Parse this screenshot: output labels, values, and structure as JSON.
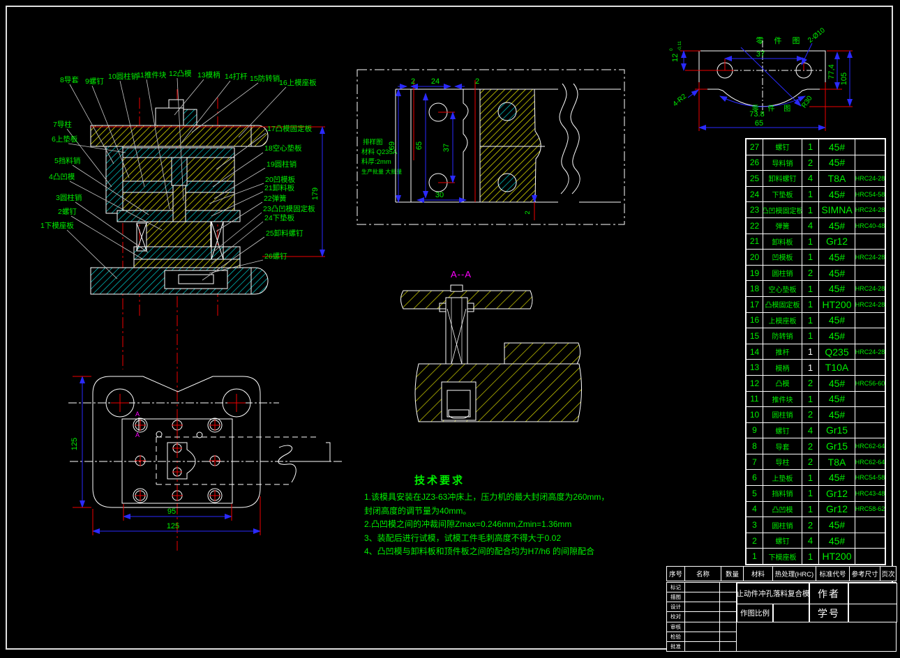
{
  "assembly": {
    "dim_height": "179",
    "labels_top": [
      "8导套",
      "9螺钉",
      "10圆柱销",
      "11推件块",
      "12凸模",
      "13模柄",
      "14打杆",
      "15防转销",
      "16上模座板"
    ],
    "labels_left": [
      "7导柱",
      "6上垫板",
      "5挡料销",
      "4凸凹模",
      "3圆柱销",
      "2螺钉",
      "1下模座板"
    ],
    "labels_right": [
      "17凸模固定板",
      "18空心垫板",
      "19圆柱销",
      "20凹模板",
      "21卸料板",
      "22弹簧",
      "23凸凹模固定板",
      "24下垫板",
      "25卸料螺钉",
      "26螺钉"
    ]
  },
  "plan": {
    "dims": {
      "left": "125",
      "inner": "95",
      "outer": "125"
    },
    "section_marker": "A"
  },
  "strip": {
    "info": [
      "排样图",
      "材料 Q235A",
      "料厚:2mm",
      "生产批量 大批量"
    ],
    "dims": {
      "t1": "2",
      "t2": "24",
      "t3": "2",
      "left": "69",
      "inner": "65",
      "center": "37",
      "bottom": "30",
      "edge": "2"
    }
  },
  "section_aa": {
    "label": "A--A"
  },
  "part": {
    "title": "零 件 图",
    "dims": {
      "tol_main": "12",
      "tol_sup": "0",
      "tol_sub": "-0,11",
      "holes": "2-Ø10",
      "centers": "37",
      "h1": "77,4",
      "h2": "105",
      "corner": "4-R2",
      "arc": "73.8",
      "radius": "R30",
      "width": "65"
    }
  },
  "tech": {
    "title": "技术要求",
    "lines": [
      "1.该模具安装在JZ3-63冲床上，压力机的最大封闭高度为260mm，",
      "封闭高度的调节量为40mm。",
      "2.凸凹模之间的冲裁间隙Zmax=0.246mm,Zmin=1.36mm",
      "3、装配后进行试模，试模工件毛刺高度不得大于0.02",
      "4、凸凹模与卸料板和顶件板之间的配合均为H7/h6 的间隙配合"
    ]
  },
  "bom": {
    "rows": [
      [
        27,
        "螺钉",
        "1",
        "45#",
        ""
      ],
      [
        26,
        "导料销",
        "2",
        "45#",
        ""
      ],
      [
        25,
        "卸料螺钉",
        "4",
        "T8A",
        "HRC24-28"
      ],
      [
        24,
        "下垫板",
        "1",
        "45#",
        "HRC54-58"
      ],
      [
        23,
        "凸凹模固定板",
        "1",
        "SIMNA",
        "HRC24-28"
      ],
      [
        22,
        "弹簧",
        "4",
        "45#",
        "HRC40-48"
      ],
      [
        21,
        "卸料板",
        "1",
        "Gr12",
        ""
      ],
      [
        20,
        "凹模板",
        "1",
        "45#",
        "HRC24-28"
      ],
      [
        19,
        "圆柱销",
        "2",
        "45#",
        ""
      ],
      [
        18,
        "空心垫板",
        "1",
        "45#",
        "HRC24-28"
      ],
      [
        17,
        "凸模固定板",
        "1",
        "HT200",
        "HRC24-28"
      ],
      [
        16,
        "上模座板",
        "1",
        "45#",
        ""
      ],
      [
        15,
        "防转销",
        "1",
        "45#",
        ""
      ],
      [
        14,
        "推杆",
        "1",
        "Q235",
        "HRC24-28"
      ],
      [
        13,
        "模柄",
        "1",
        "T10A",
        ""
      ],
      [
        12,
        "凸模",
        "2",
        "45#",
        "HRC56-60"
      ],
      [
        11,
        "推件块",
        "1",
        "45#",
        ""
      ],
      [
        10,
        "圆柱销",
        "2",
        "45#",
        ""
      ],
      [
        9,
        "螺钉",
        "4",
        "Gr15",
        ""
      ],
      [
        8,
        "导套",
        "2",
        "Gr15",
        "HRC62-64"
      ],
      [
        7,
        "导柱",
        "2",
        "T8A",
        "HRC62-64"
      ],
      [
        6,
        "上垫板",
        "1",
        "45#",
        "HRC54-58"
      ],
      [
        5,
        "挡料销",
        "1",
        "Gr12",
        "HRC43-48"
      ],
      [
        4,
        "凸凹模",
        "1",
        "Gr12",
        "HRC58-62"
      ],
      [
        3,
        "圆柱销",
        "2",
        "45#",
        ""
      ],
      [
        2,
        "螺钉",
        "4",
        "45#",
        ""
      ],
      [
        1,
        "下模座板",
        "1",
        "HT200",
        ""
      ]
    ],
    "white_qty_rows": [
      14,
      13
    ]
  },
  "titleblock": {
    "header": [
      "序号",
      "名称",
      "数量",
      "材料",
      "热处理(HRC)",
      "标准代号",
      "参考尺寸",
      "页次"
    ],
    "left_rows": [
      "标记",
      "描图",
      "设计",
      "校对",
      "审核",
      "检验",
      "批准"
    ],
    "title": "止动件冲孔落料复合模",
    "scale_label": "作图比例",
    "author_label": "作者",
    "id_label": "学号"
  }
}
